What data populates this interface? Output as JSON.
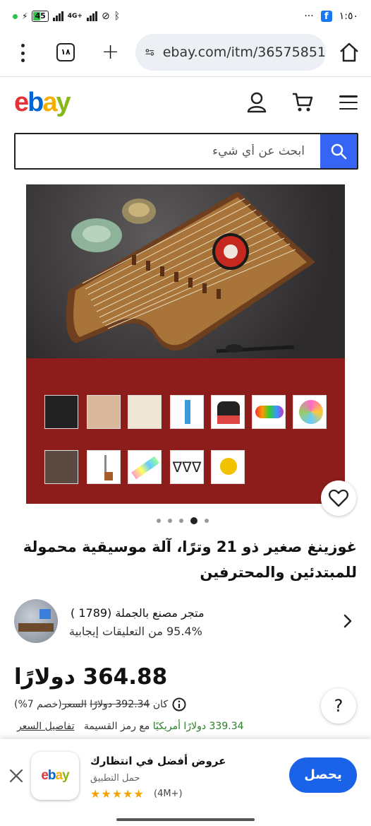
{
  "status_bar": {
    "battery": "45",
    "network": "4G+",
    "time": "١:٥٠",
    "more": "···"
  },
  "browser": {
    "tab_count": "١٨",
    "url": "ebay.com/itm/36575851"
  },
  "header": {
    "logo": {
      "e": "e",
      "b": "b",
      "a": "a",
      "y": "y"
    }
  },
  "search": {
    "placeholder": "ابحث عن أي شيء"
  },
  "carousel": {
    "image_count": 5,
    "active_index": 3
  },
  "product": {
    "title": "غوزينغ صغير ذو 21 وترًا، آلة موسيقية محمولة للمبتدئين والمحترفين"
  },
  "seller": {
    "name": "متجر مصنع بالجملة (1789 )",
    "feedback": "95.4% من التعليقات إيجابية"
  },
  "price": {
    "current": "364.88 دولارًا",
    "discount": "(خصم 7%)",
    "was_label": "السعر",
    "was_price": "392.34 دولارًا",
    "was_suffix": "كان",
    "installment_prefix": "مع رمز القسيمة",
    "installment_amount": "339.34 دولارًا أمريكيًا",
    "details_link": "تفاصيل السعر"
  },
  "app_banner": {
    "app_name": "ebay",
    "title": "عروض أفضل في انتظارك",
    "subtitle": "حمل التطبيق",
    "stars": "★★★★★",
    "reviews": "(4M+)",
    "button": "يحصل"
  },
  "help": {
    "label": "?"
  },
  "colors": {
    "ebay_blue": "#3665f3",
    "banner_button": "#1a62e8",
    "green_price": "#2a7b2a",
    "image_red": "#8c1d1a"
  }
}
